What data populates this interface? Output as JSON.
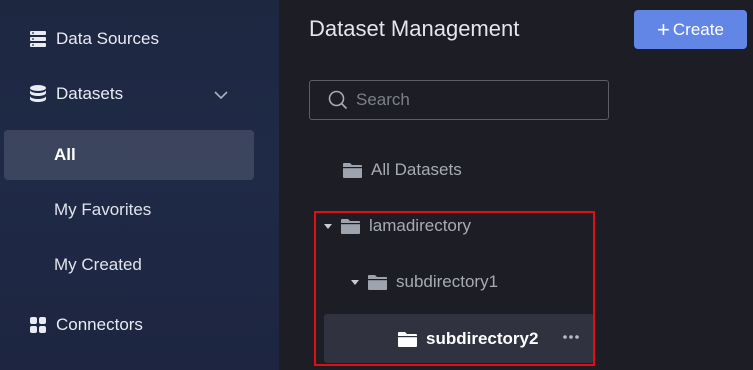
{
  "sidebar": {
    "items": [
      {
        "label": "Data Sources",
        "icon": "database-list-icon"
      },
      {
        "label": "Datasets",
        "icon": "datasets-icon",
        "expanded": true
      },
      {
        "label": "Connectors",
        "icon": "connectors-icon"
      }
    ],
    "sub_items": [
      {
        "label": "All",
        "active": true
      },
      {
        "label": "My Favorites",
        "active": false
      },
      {
        "label": "My Created",
        "active": false
      }
    ]
  },
  "main": {
    "title": "Dataset Management",
    "create_label": "Create",
    "search_placeholder": "Search",
    "tree": [
      {
        "label": "All Datasets",
        "depth": 0
      },
      {
        "label": "lamadirectory",
        "depth": 0,
        "expanded": true
      },
      {
        "label": "subdirectory1",
        "depth": 1,
        "expanded": true
      },
      {
        "label": "subdirectory2",
        "depth": 2,
        "selected": true
      }
    ]
  },
  "colors": {
    "accent": "#6286e6",
    "highlight": "#e01010",
    "sidebar_bg": "#1f2a47",
    "main_bg": "#1c1d25"
  }
}
